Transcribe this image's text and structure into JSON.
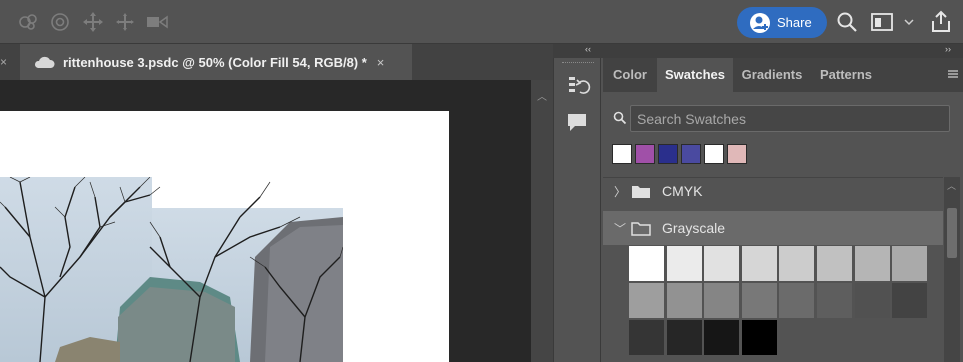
{
  "toolbar": {
    "icons": [
      "orbit-3d-icon",
      "roll-3d-icon",
      "pan-3d-icon",
      "slide-3d-icon",
      "scale-3d-video-icon"
    ],
    "share_label": "Share",
    "right_icons": [
      "search-icon",
      "workspace-icon",
      "chevron-down-icon",
      "export-icon"
    ]
  },
  "document": {
    "tab_title": "rittenhouse 3.psdc @ 50% (Color Fill 54, RGB/8) *",
    "close_glyph": "×",
    "left_close_glyph": "×"
  },
  "panel": {
    "tabs": [
      {
        "label": "Color",
        "active": false
      },
      {
        "label": "Swatches",
        "active": true
      },
      {
        "label": "Gradients",
        "active": false
      },
      {
        "label": "Patterns",
        "active": false
      }
    ],
    "search_placeholder": "Search Swatches",
    "recent_swatches": [
      "#ffffff",
      "#a050a8",
      "#2a2f8c",
      "#4a4aa0",
      "#ffffff",
      "#e0b8b8"
    ],
    "groups": [
      {
        "name": "CMYK",
        "expanded": false
      },
      {
        "name": "Grayscale",
        "expanded": true
      }
    ],
    "grayscale_swatches": [
      [
        "#ffffff",
        "#ebebeb",
        "#e1e1e1",
        "#d6d6d6",
        "#cccccc",
        "#c1c1c1",
        "#b5b5b5",
        "#aaaaaa"
      ],
      [
        "#9e9e9e",
        "#929292",
        "#858585",
        "#787878",
        "#6b6b6b",
        "#5e5e5e",
        "#515151",
        "#434343"
      ],
      [
        "#353535",
        "#262626",
        "#161616",
        "#000000"
      ]
    ]
  },
  "colors": {
    "accent": "#2f6cc0",
    "panel_bg": "#535353",
    "canvas_bg": "#282828"
  }
}
